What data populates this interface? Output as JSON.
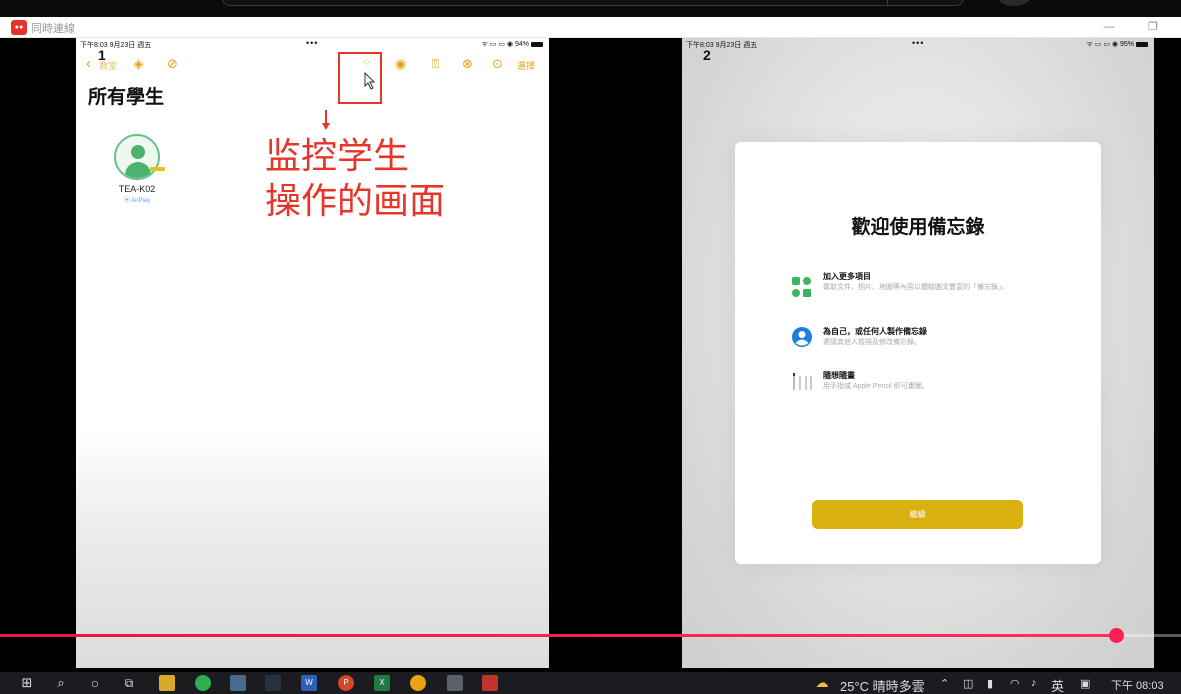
{
  "window": {
    "title": "同時連線",
    "app_icon_text": "●●"
  },
  "panel_left": {
    "number": "1",
    "status": {
      "time_date": "下午8:03  9月23日 週五",
      "dots": "•••",
      "battery": "94%"
    },
    "nav": {
      "back_label": "教室",
      "select_label": "選擇"
    },
    "title": "所有學生",
    "student": {
      "name": "TEA-K02",
      "sub": "⦿ AirPlay"
    },
    "annotation": {
      "line1": "监控学生",
      "line2": "操作的画面"
    }
  },
  "panel_right": {
    "number": "2",
    "status": {
      "time_date": "下午8:03  9月23日 週五",
      "dots": "•••",
      "battery": "95%"
    },
    "welcome": {
      "title": "歡迎使用備忘錄",
      "features": [
        {
          "icon": "attachment-grid-icon",
          "title": "加入更多項目",
          "desc": "載取文件、相片、地圖等內容以體驗圖文豐富的「備忘錄」。"
        },
        {
          "icon": "person-circle-icon",
          "title": "為自己，或任何人製作備忘錄",
          "desc": "邀請其他人檢視及修改備忘錄。"
        },
        {
          "icon": "pencil-set-icon",
          "title": "隨想隨畫",
          "desc": "用手指或 Apple Pencil 即可畫圖。"
        }
      ],
      "continue_label": "繼續"
    }
  },
  "video": {
    "progress": 0.945
  },
  "taskbar": {
    "weather": "25°C  晴時多雲",
    "ime": "英",
    "time": "下午 08:03"
  },
  "colors": {
    "accent_orange": "#e3a21a",
    "annotation_red": "#e8352a",
    "progress_red": "#ff1f4f",
    "continue_yellow": "#d8b010"
  }
}
